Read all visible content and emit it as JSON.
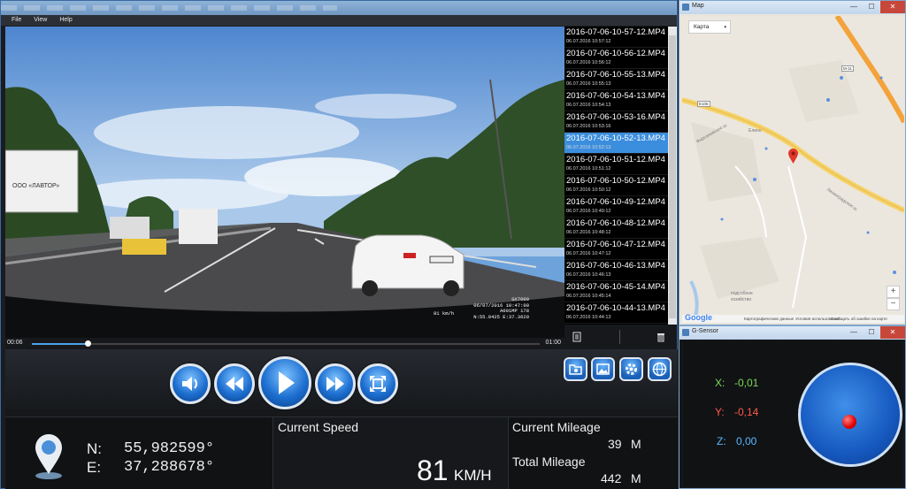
{
  "menu": [
    "File",
    "View",
    "Help"
  ],
  "video": {
    "overlay_model": "GX7000",
    "overlay_datetime": "06/07/2016 10:47:00",
    "overlay_plate": "A001MP 178",
    "overlay_coords": "N:55.9425 E:37.3620",
    "overlay_speed": "81 km/h",
    "time_current": "00:06",
    "time_total": "01:00",
    "progress": 0.11
  },
  "files": [
    {
      "name": "2016-07-06-10-57-12.MP4",
      "date": "06.07.2016 10:57:12"
    },
    {
      "name": "2016-07-06-10-56-12.MP4",
      "date": "06.07.2016 10:56:12"
    },
    {
      "name": "2016-07-06-10-55-13.MP4",
      "date": "06.07.2016 10:55:13"
    },
    {
      "name": "2016-07-06-10-54-13.MP4",
      "date": "06.07.2016 10:54:13"
    },
    {
      "name": "2016-07-06-10-53-16.MP4",
      "date": "06.07.2016 10:53:16"
    },
    {
      "name": "2016-07-06-10-52-13.MP4",
      "date": "06.07.2016 10:52:13",
      "selected": true
    },
    {
      "name": "2016-07-06-10-51-12.MP4",
      "date": "06.07.2016 10:51:12"
    },
    {
      "name": "2016-07-06-10-50-12.MP4",
      "date": "06.07.2016 10:50:12"
    },
    {
      "name": "2016-07-06-10-49-12.MP4",
      "date": "06.07.2016 10:49:12"
    },
    {
      "name": "2016-07-06-10-48-12.MP4",
      "date": "06.07.2016 10:48:12"
    },
    {
      "name": "2016-07-06-10-47-12.MP4",
      "date": "06.07.2016 10:47:12"
    },
    {
      "name": "2016-07-06-10-46-13.MP4",
      "date": "06.07.2016 10:46:13"
    },
    {
      "name": "2016-07-06-10-45-14.MP4",
      "date": "06.07.2016 10:45:14"
    },
    {
      "name": "2016-07-06-10-44-13.MP4",
      "date": "06.07.2016 10:44:13"
    }
  ],
  "gps": {
    "n_label": "N:",
    "n_value": "55,982599°",
    "e_label": "E:",
    "e_value": "37,288678°"
  },
  "speed": {
    "label": "Current Speed",
    "value": "81",
    "unit": "KM/H"
  },
  "mileage": {
    "current_label": "Current Mileage",
    "current_value": "39",
    "current_unit": "M",
    "total_label": "Total Mileage",
    "total_value": "442",
    "total_unit": "M"
  },
  "map_window": {
    "title": "Map",
    "map_type": "Карта",
    "zoom_in": "+",
    "zoom_out": "−",
    "road_badge_1": "M-11",
    "road_badge_2": "E105",
    "label_village": "Елино",
    "label_street1": "Фирсановское ш.",
    "label_street2": "Ленинградское ш.",
    "label_farm1": "подсобное",
    "label_farm2": "хозяйство",
    "google": "Google",
    "footer_data": "Картографические данные",
    "footer_terms": "Условия использования",
    "footer_report": "Сообщить об ошибке на карте"
  },
  "gsensor_window": {
    "title": "G-Sensor",
    "x_label": "X:",
    "x_value": "-0,01",
    "y_label": "Y:",
    "y_value": "-0,14",
    "z_label": "Z:",
    "z_value": "0,00",
    "x_color": "#7ed957",
    "y_color": "#ff5a4a",
    "z_color": "#5ab8ff"
  },
  "colors": {
    "accent": "#3b8ede",
    "selected_row": "#3b8ede"
  }
}
